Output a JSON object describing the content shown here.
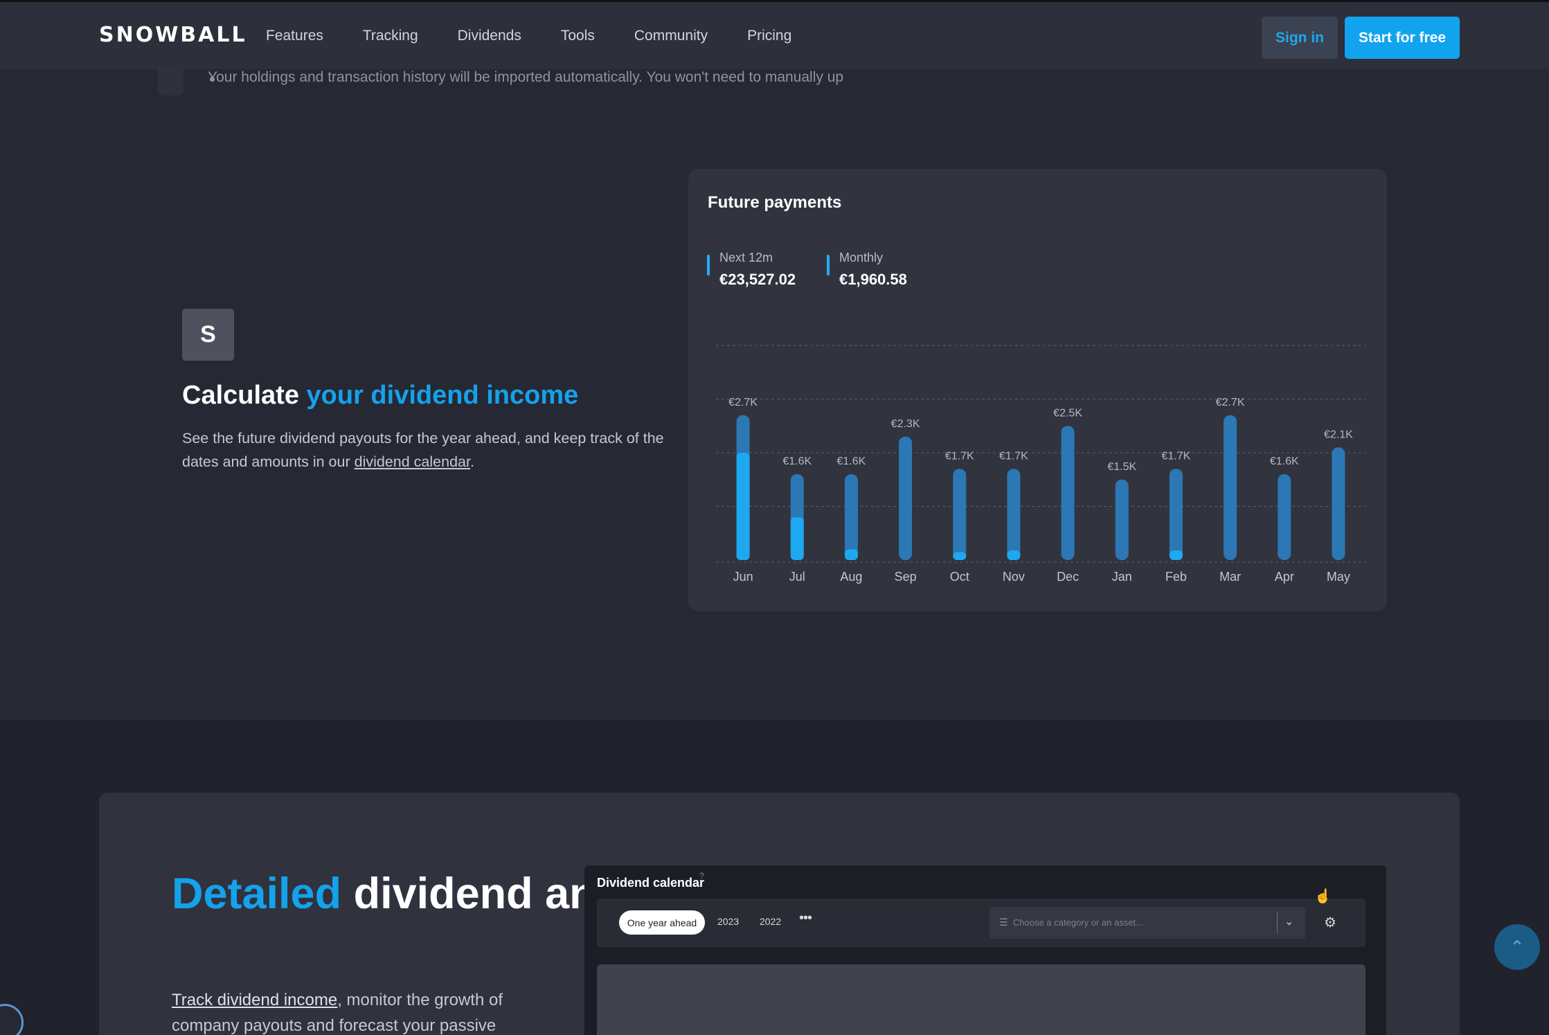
{
  "nav": {
    "logo": "SNOWBALL",
    "items": [
      "Features",
      "Tracking",
      "Dividends",
      "Tools",
      "Community",
      "Pricing"
    ],
    "signin": "Sign in",
    "start": "Start for free"
  },
  "previous": {
    "bullet_text": "Your holdings and transaction history will be imported automatically. You won't need to manually up"
  },
  "calculate": {
    "icon_letter": "S",
    "title_plain": "Calculate ",
    "title_accent": "your dividend income",
    "body_before": "See the future dividend payouts for the year ahead, and keep track of the dates and amounts in our ",
    "body_link": "dividend calendar",
    "body_after": "."
  },
  "future_payments": {
    "title": "Future payments",
    "next12_label": "Next 12m",
    "next12_value": "€23,527.02",
    "monthly_label": "Monthly",
    "monthly_value": "€1,960.58"
  },
  "chart_data": {
    "type": "bar",
    "title": "Future payments",
    "categories": [
      "Jun",
      "Jul",
      "Aug",
      "Sep",
      "Oct",
      "Nov",
      "Dec",
      "Jan",
      "Feb",
      "Mar",
      "Apr",
      "May"
    ],
    "values": [
      2.7,
      1.6,
      1.6,
      2.3,
      1.7,
      1.7,
      2.5,
      1.5,
      1.7,
      2.7,
      1.6,
      2.1
    ],
    "paid_portion": [
      2.0,
      0.8,
      0.2,
      0,
      0.15,
      0.18,
      0,
      0,
      0.18,
      0,
      0,
      0
    ],
    "data_labels": [
      "€2.7K",
      "€1.6K",
      "€1.6K",
      "€2.3K",
      "€1.7K",
      "€1.7K",
      "€2.5K",
      "€1.5K",
      "€1.7K",
      "€2.7K",
      "€1.6K",
      "€2.1K"
    ],
    "unit": "K EUR",
    "ylim": [
      0,
      4
    ],
    "grid": true,
    "colors": {
      "projected": "#2b78b4",
      "paid": "#1ea8f0",
      "grid": "#5a5d69"
    }
  },
  "detailed": {
    "title_accent": "Detailed",
    "title_rest": " dividend analytics",
    "body_link": "Track dividend income",
    "body_rest": ", monitor the growth of company payouts and forecast your passive"
  },
  "calendar": {
    "title": "Dividend calendar",
    "help_icon": "?",
    "tab_active": "One year ahead",
    "tab_2023": "2023",
    "tab_2022": "2022",
    "more": "•••",
    "filter_placeholder": "Choose a category or an asset...",
    "icons": [
      "filter-icon",
      "chevron-down-icon",
      "gear-icon"
    ]
  },
  "colors": {
    "accent": "#14a2eb",
    "background": "#262834",
    "card": "#31333f"
  }
}
